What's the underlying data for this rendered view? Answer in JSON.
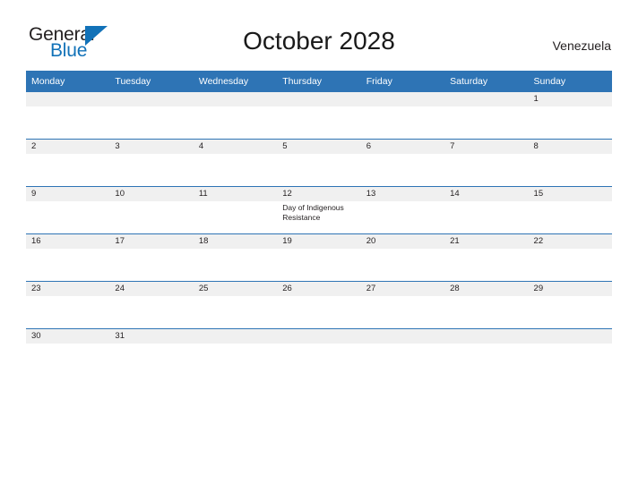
{
  "brand": {
    "word_one": "General",
    "word_two": "Blue",
    "flag_icon": "triangle-flag-icon",
    "colors": {
      "dark": "#231f20",
      "blue": "#1272b8"
    }
  },
  "header": {
    "title": "October 2028",
    "region": "Venezuela"
  },
  "theme": {
    "header_blue": "#2e74b5",
    "daynum_band": "#f0f0f0",
    "text": "#231f20"
  },
  "calendar": {
    "weekday_headers": [
      "Monday",
      "Tuesday",
      "Wednesday",
      "Thursday",
      "Friday",
      "Saturday",
      "Sunday"
    ],
    "weeks": [
      [
        {
          "day": "",
          "events": []
        },
        {
          "day": "",
          "events": []
        },
        {
          "day": "",
          "events": []
        },
        {
          "day": "",
          "events": []
        },
        {
          "day": "",
          "events": []
        },
        {
          "day": "",
          "events": []
        },
        {
          "day": "1",
          "events": []
        }
      ],
      [
        {
          "day": "2",
          "events": []
        },
        {
          "day": "3",
          "events": []
        },
        {
          "day": "4",
          "events": []
        },
        {
          "day": "5",
          "events": []
        },
        {
          "day": "6",
          "events": []
        },
        {
          "day": "7",
          "events": []
        },
        {
          "day": "8",
          "events": []
        }
      ],
      [
        {
          "day": "9",
          "events": []
        },
        {
          "day": "10",
          "events": []
        },
        {
          "day": "11",
          "events": []
        },
        {
          "day": "12",
          "events": [
            "Day of Indigenous Resistance"
          ]
        },
        {
          "day": "13",
          "events": []
        },
        {
          "day": "14",
          "events": []
        },
        {
          "day": "15",
          "events": []
        }
      ],
      [
        {
          "day": "16",
          "events": []
        },
        {
          "day": "17",
          "events": []
        },
        {
          "day": "18",
          "events": []
        },
        {
          "day": "19",
          "events": []
        },
        {
          "day": "20",
          "events": []
        },
        {
          "day": "21",
          "events": []
        },
        {
          "day": "22",
          "events": []
        }
      ],
      [
        {
          "day": "23",
          "events": []
        },
        {
          "day": "24",
          "events": []
        },
        {
          "day": "25",
          "events": []
        },
        {
          "day": "26",
          "events": []
        },
        {
          "day": "27",
          "events": []
        },
        {
          "day": "28",
          "events": []
        },
        {
          "day": "29",
          "events": []
        }
      ],
      [
        {
          "day": "30",
          "events": []
        },
        {
          "day": "31",
          "events": []
        },
        {
          "day": "",
          "events": []
        },
        {
          "day": "",
          "events": []
        },
        {
          "day": "",
          "events": []
        },
        {
          "day": "",
          "events": []
        },
        {
          "day": "",
          "events": []
        }
      ]
    ]
  }
}
